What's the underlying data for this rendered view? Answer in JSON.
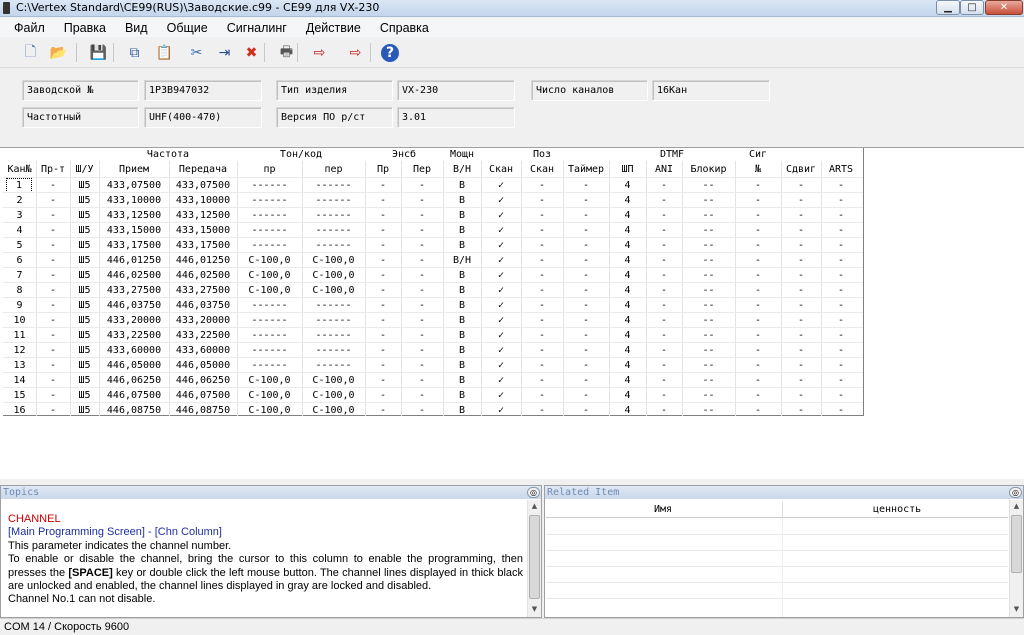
{
  "window": {
    "title": "C:\\Vertex Standard\\CE99(RUS)\\Заводские.c99 - CE99 для VX-230",
    "min_icon": "minimize-icon",
    "max_icon": "maximize-icon",
    "close_icon": "close-icon",
    "min_glyph": "▁",
    "max_glyph": "□",
    "close_glyph": "✕"
  },
  "menu": [
    "Файл",
    "Правка",
    "Вид",
    "Общие",
    "Сигналинг",
    "Действие",
    "Справка"
  ],
  "toolbar": [
    {
      "name": "new-file-icon",
      "glyph": "🗋",
      "color": "#4a72b8"
    },
    {
      "name": "open-folder-icon",
      "glyph": "📂",
      "color": "#d9a441"
    },
    {
      "name": "save-icon",
      "glyph": "💾",
      "color": "#2f4f9a"
    },
    {
      "name": "copy-icon",
      "glyph": "⧉",
      "color": "#2f5fa8"
    },
    {
      "name": "paste-icon",
      "glyph": "📋",
      "color": "#b58a2a"
    },
    {
      "name": "cut-icon",
      "glyph": "✂",
      "color": "#3a6db0"
    },
    {
      "name": "insert-icon",
      "glyph": "⇥",
      "color": "#2a4f8a"
    },
    {
      "name": "delete-icon",
      "glyph": "✖",
      "color": "#d03020"
    },
    {
      "name": "print-icon",
      "glyph": "🖶",
      "color": "#555555"
    },
    {
      "name": "read-radio-icon",
      "glyph": "⇨",
      "color": "#c02020"
    },
    {
      "name": "write-radio-icon",
      "glyph": "⇨",
      "color": "#c02020"
    },
    {
      "name": "help-icon",
      "glyph": "?",
      "color": "#2a5ab8"
    }
  ],
  "info": {
    "serial_label": "Заводской №",
    "serial_value": "1P3B947032",
    "model_label": "Тип изделия",
    "model_value": "VX-230",
    "channels_label": "Число каналов",
    "channels_value": "16Кан",
    "freq_label": "Частотный",
    "freq_value": "UHF(400-470)",
    "version_label": "Версия ПО р/ст",
    "version_value": "3.01"
  },
  "grid": {
    "group_headers": [
      "Частота",
      "Тон/код",
      "Энсб",
      "Мощн",
      "Поз",
      "DTMF",
      "Сиг"
    ],
    "headers": [
      "Кан№",
      "Пр-т",
      "Ш/У",
      "Прием",
      "Передача",
      "пр",
      "пер",
      "Пр",
      "Пер",
      "В/Н",
      "Скан",
      "Скан",
      "Таймер",
      "ШП",
      "ANI",
      "Блокир",
      "№",
      "Сдвиг",
      "ARTS"
    ],
    "rows": [
      [
        "1",
        "-",
        "Ш5",
        "433,07500",
        "433,07500",
        "------",
        "------",
        "-",
        "-",
        "В",
        "✓",
        "-",
        "-",
        "4",
        "-",
        "--",
        "-",
        "-",
        "-"
      ],
      [
        "2",
        "-",
        "Ш5",
        "433,10000",
        "433,10000",
        "------",
        "------",
        "-",
        "-",
        "В",
        "✓",
        "-",
        "-",
        "4",
        "-",
        "--",
        "-",
        "-",
        "-"
      ],
      [
        "3",
        "-",
        "Ш5",
        "433,12500",
        "433,12500",
        "------",
        "------",
        "-",
        "-",
        "В",
        "✓",
        "-",
        "-",
        "4",
        "-",
        "--",
        "-",
        "-",
        "-"
      ],
      [
        "4",
        "-",
        "Ш5",
        "433,15000",
        "433,15000",
        "------",
        "------",
        "-",
        "-",
        "В",
        "✓",
        "-",
        "-",
        "4",
        "-",
        "--",
        "-",
        "-",
        "-"
      ],
      [
        "5",
        "-",
        "Ш5",
        "433,17500",
        "433,17500",
        "------",
        "------",
        "-",
        "-",
        "В",
        "✓",
        "-",
        "-",
        "4",
        "-",
        "--",
        "-",
        "-",
        "-"
      ],
      [
        "6",
        "-",
        "Ш5",
        "446,01250",
        "446,01250",
        "C-100,0",
        "C-100,0",
        "-",
        "-",
        "В/Н",
        "✓",
        "-",
        "-",
        "4",
        "-",
        "--",
        "-",
        "-",
        "-"
      ],
      [
        "7",
        "-",
        "Ш5",
        "446,02500",
        "446,02500",
        "C-100,0",
        "C-100,0",
        "-",
        "-",
        "В",
        "✓",
        "-",
        "-",
        "4",
        "-",
        "--",
        "-",
        "-",
        "-"
      ],
      [
        "8",
        "-",
        "Ш5",
        "433,27500",
        "433,27500",
        "C-100,0",
        "C-100,0",
        "-",
        "-",
        "В",
        "✓",
        "-",
        "-",
        "4",
        "-",
        "--",
        "-",
        "-",
        "-"
      ],
      [
        "9",
        "-",
        "Ш5",
        "446,03750",
        "446,03750",
        "------",
        "------",
        "-",
        "-",
        "В",
        "✓",
        "-",
        "-",
        "4",
        "-",
        "--",
        "-",
        "-",
        "-"
      ],
      [
        "10",
        "-",
        "Ш5",
        "433,20000",
        "433,20000",
        "------",
        "------",
        "-",
        "-",
        "В",
        "✓",
        "-",
        "-",
        "4",
        "-",
        "--",
        "-",
        "-",
        "-"
      ],
      [
        "11",
        "-",
        "Ш5",
        "433,22500",
        "433,22500",
        "------",
        "------",
        "-",
        "-",
        "В",
        "✓",
        "-",
        "-",
        "4",
        "-",
        "--",
        "-",
        "-",
        "-"
      ],
      [
        "12",
        "-",
        "Ш5",
        "433,60000",
        "433,60000",
        "------",
        "------",
        "-",
        "-",
        "В",
        "✓",
        "-",
        "-",
        "4",
        "-",
        "--",
        "-",
        "-",
        "-"
      ],
      [
        "13",
        "-",
        "Ш5",
        "446,05000",
        "446,05000",
        "------",
        "------",
        "-",
        "-",
        "В",
        "✓",
        "-",
        "-",
        "4",
        "-",
        "--",
        "-",
        "-",
        "-"
      ],
      [
        "14",
        "-",
        "Ш5",
        "446,06250",
        "446,06250",
        "C-100,0",
        "C-100,0",
        "-",
        "-",
        "В",
        "✓",
        "-",
        "-",
        "4",
        "-",
        "--",
        "-",
        "-",
        "-"
      ],
      [
        "15",
        "-",
        "Ш5",
        "446,07500",
        "446,07500",
        "C-100,0",
        "C-100,0",
        "-",
        "-",
        "В",
        "✓",
        "-",
        "-",
        "4",
        "-",
        "--",
        "-",
        "-",
        "-"
      ],
      [
        "16",
        "-",
        "Ш5",
        "446,08750",
        "446,08750",
        "C-100,0",
        "C-100,0",
        "-",
        "-",
        "В",
        "✓",
        "-",
        "-",
        "4",
        "-",
        "--",
        "-",
        "-",
        "-"
      ]
    ]
  },
  "topics": {
    "title": "Topics",
    "heading": "CHANNEL",
    "heading_color": "#cc0000",
    "link": "[Main Programming Screen] - [Chn Column]",
    "link_color": "#1a2fa0",
    "line1": "This parameter indicates the channel number.",
    "line2a": "To enable or disable the channel, bring the cursor to this column to enable the programming, then presses the ",
    "line2b": "[SPACE]",
    "line2c": " key or double click the left mouse button. The channel lines displayed in thick black are unlocked and enabled, the channel lines displayed in gray are locked and disabled.",
    "line3": "Channel No.1 can not disable."
  },
  "related": {
    "title": "Related Item",
    "col_name": "Имя",
    "col_value": "ценность"
  },
  "status": {
    "text": "COM 14 / Скорость 9600"
  }
}
